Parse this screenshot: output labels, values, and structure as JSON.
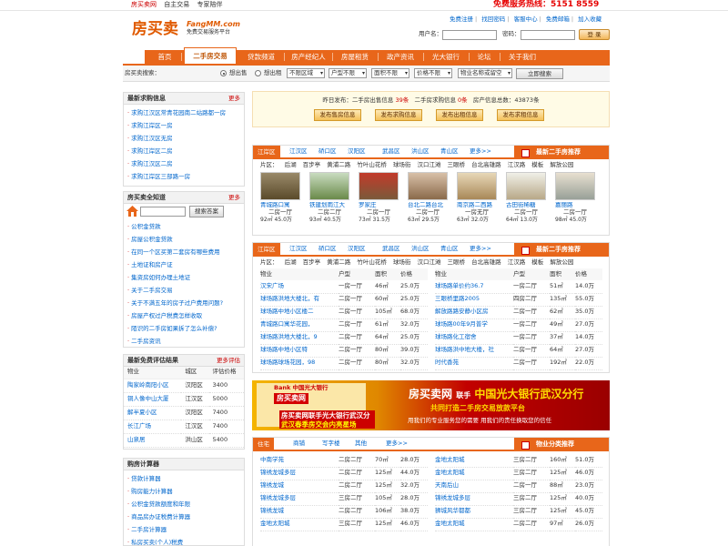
{
  "topbar": {
    "site": "房买卖网",
    "t1": "自主交易",
    "t2": "专家陪伴",
    "hotline": "免费服务热线：5151 8559"
  },
  "logo": {
    "cn": "房买卖",
    "en": "FangMM.com",
    "sub": "免费交易服务平台"
  },
  "links": [
    "免费注册",
    "找回密码",
    "客服中心",
    "免费邮箱",
    "加入收藏"
  ],
  "login": {
    "user_label": "用户名：",
    "pass_label": "密码：",
    "button": "登 录"
  },
  "nav": [
    "首页",
    "二手房交易",
    "贷款频道",
    "房产经纪人",
    "房屋租赁",
    "政产资讯",
    "光大银行",
    "论坛",
    "关于我们"
  ],
  "searchbar": {
    "label": "房买卖搜索：",
    "radio1": "想出售",
    "radio2": "想出租",
    "sel_area": "不限区域",
    "sel_type": "户型不限",
    "sel_size": "面积不限",
    "sel_price": "价格不限",
    "keyword_placeholder": "物业名称或留空",
    "button": "立即搜索"
  },
  "left": {
    "latest": {
      "title": "最新求购信息",
      "more": "更多",
      "items": [
        "求购江汉区常青花园南二站路都一房",
        "求购江岸区一房",
        "求购江汉区无房",
        "求购江岸区二房",
        "求购江汉区二房",
        "求购江岸区三部路一房"
      ]
    },
    "knowledge": {
      "title": "房买卖全知道",
      "more": "更多",
      "button": "搜索答案",
      "items": [
        "公积金贷款",
        "房屋公积金贷款",
        "在同一个区买第二套房有哪些费用",
        "土地证和房产证",
        "集资房如何办理土地证",
        "关于二手房交易",
        "关于不满五年的房子过户费用问题?",
        "房屋产权过户税费怎样收取",
        "陌识的二手房如果拆了怎么补偿?",
        "二手房资讯"
      ]
    },
    "estimate": {
      "title": "最新免费评估结果",
      "more": "更多评估",
      "cols": [
        "物业",
        "城区",
        "评估价格"
      ],
      "rows": [
        [
          "陶家岭南阳小区",
          "汉阳区",
          "3400"
        ],
        [
          "铜人像中山大厦",
          "江汉区",
          "5000"
        ],
        [
          "解半夏小区",
          "汉阳区",
          "7400"
        ],
        [
          "长江广场",
          "江汉区",
          "7400"
        ],
        [
          "山泉居",
          "洪山区",
          "5400"
        ]
      ]
    },
    "calc": {
      "title": "购房计算器",
      "items": [
        "贷款计算器",
        "购房能力计算器",
        "公积金贷款额度和年限",
        "商品房办证税费计算器",
        "二手房计算器",
        "私房买卖(个人)税费"
      ]
    }
  },
  "notice": {
    "pre": "昨日发布：二手房出售信息",
    "n1": "39条",
    "mid": "二手房求购信息",
    "n2": "0条",
    "post": "房产信息总数：43873条",
    "buttons": [
      "发布售房信息",
      "发布求购信息",
      "发布出租信息",
      "发布求租信息"
    ]
  },
  "sec1": {
    "tabs": [
      "江岸区",
      "江汉区",
      "硚口区",
      "汉阳区",
      "武昌区",
      "洪山区",
      "青山区",
      "更多>>"
    ],
    "badge": "最新二手房推荐",
    "area_label": "片区：",
    "areas": [
      "后湖",
      "百步亭",
      "黄浦二路",
      "竹叶山花桥",
      "球场街",
      "汉口江滩",
      "三眼桥",
      "台北高雄路",
      "江汉路",
      "模板",
      "解放公园"
    ],
    "thumbs": [
      {
        "n": "青城路口寓",
        "h": "二房一厅",
        "p": "92㎡ 45.0万"
      },
      {
        "n": "铁建划雨江大",
        "h": "二房二厅",
        "p": "93㎡ 40.5万"
      },
      {
        "n": "罗家庄",
        "h": "二房一厅",
        "p": "73㎡ 31.5万"
      },
      {
        "n": "台北二路台北",
        "h": "二房一厅",
        "p": "63㎡ 29.5万"
      },
      {
        "n": "南京路二西路",
        "h": "一房无厅",
        "p": "63㎡ 32.0万"
      },
      {
        "n": "古田街稀糖",
        "h": "二房一厅",
        "p": "64㎡ 13.0万"
      },
      {
        "n": "嘉丽路",
        "h": "二房一厅",
        "p": "98㎡ 45.0万"
      }
    ]
  },
  "sec2": {
    "tabs": [
      "江岸区",
      "江汉区",
      "硚口区",
      "汉阳区",
      "武昌区",
      "洪山区",
      "青山区",
      "更多>>"
    ],
    "badge": "最新二手房推荐",
    "area_label": "片区：",
    "areas": [
      "后湖",
      "百步亭",
      "黄浦二路",
      "竹叶山花桥",
      "球场街",
      "汉口江滩",
      "三眼桥",
      "台北高雄路",
      "江汉路",
      "模板",
      "解放公园"
    ],
    "cols": [
      "物业",
      "户型",
      "面积",
      "价格"
    ],
    "left": [
      [
        "汉宋广场",
        "一房一厅",
        "46㎡",
        "25.0万"
      ],
      [
        "球场路洪地大楼北，有",
        "二房一厅",
        "60㎡",
        "25.0万"
      ],
      [
        "球场路中地小区楼二",
        "二房一厅",
        "105㎡",
        "68.0万"
      ],
      [
        "青城路口寓华花园，",
        "二房一厅",
        "61㎡",
        "32.0万"
      ],
      [
        "球场路洪地大楼北，9",
        "二房一厅",
        "64㎡",
        "25.0万"
      ],
      [
        "球场路中地小区特",
        "二房一厅",
        "80㎡",
        "39.0万"
      ],
      [
        "球场路球场花园，98",
        "二房一厅",
        "80㎡",
        "32.0万"
      ]
    ],
    "right": [
      [
        "球场路单价约36.7",
        "一房二厅",
        "51㎡",
        "14.0万"
      ],
      [
        "三眼桥里路2005",
        "四房二厅",
        "135㎡",
        "55.0万"
      ],
      [
        "解放路路安静小区房",
        "二房一厅",
        "62㎡",
        "35.0万"
      ],
      [
        "球场路00年9月普学",
        "一房二厅",
        "49㎡",
        "27.0万"
      ],
      [
        "球场路化工宿舍",
        "一房二厅",
        "37㎡",
        "14.0万"
      ],
      [
        "球场路洪中地大楼，社",
        "二房一厅",
        "64㎡",
        "27.0万"
      ],
      [
        "时代香苑",
        "二房一厅",
        "192㎡",
        "22.0万"
      ]
    ]
  },
  "banner": {
    "bank": "Bank 中国光大银行",
    "fm": "房买卖网",
    "t1": "房买卖网联手光大银行武汉分行",
    "t2": "武汉春季房交会内亮星场",
    "r1a": "房买卖网",
    "r1b": "联手",
    "r1c": "中国光大银行武汉分行",
    "r2": "共同打造二手房交易放款平台",
    "r3": "用我们的专业服务您的需要   用我们的责任换取您的信任"
  },
  "sec3": {
    "tabs": [
      "住宅",
      "商铺",
      "写字楼",
      "其他",
      "更多>>"
    ],
    "badge": "物业分类推荐",
    "left": [
      [
        "中南学苑",
        "二房二厅",
        "70㎡",
        "28.0万"
      ],
      [
        "锦绣龙城多层",
        "二房二厅",
        "125㎡",
        "44.0万"
      ],
      [
        "锦绣龙城",
        "二房二厅",
        "125㎡",
        "32.0万"
      ],
      [
        "锦绣龙城多层",
        "三房二厅",
        "105㎡",
        "28.0万"
      ],
      [
        "锦绣龙城",
        "二房二厅",
        "106㎡",
        "38.0万"
      ],
      [
        "金地太阳城",
        "三房二厅",
        "125㎡",
        "46.0万"
      ]
    ],
    "right": [
      [
        "金地太阳城",
        "三房二厅",
        "160㎡",
        "51.0万"
      ],
      [
        "金地太阳城",
        "三房二厅",
        "125㎡",
        "46.0万"
      ],
      [
        "天南后山",
        "二房一厅",
        "88㎡",
        "23.0万"
      ],
      [
        "锦绣龙城多层",
        "三房二厅",
        "125㎡",
        "40.0万"
      ],
      [
        "狮城风华都都",
        "三房二厅",
        "125㎡",
        "45.0万"
      ],
      [
        "金地太阳城",
        "二房二厅",
        "97㎡",
        "26.0万"
      ]
    ]
  }
}
